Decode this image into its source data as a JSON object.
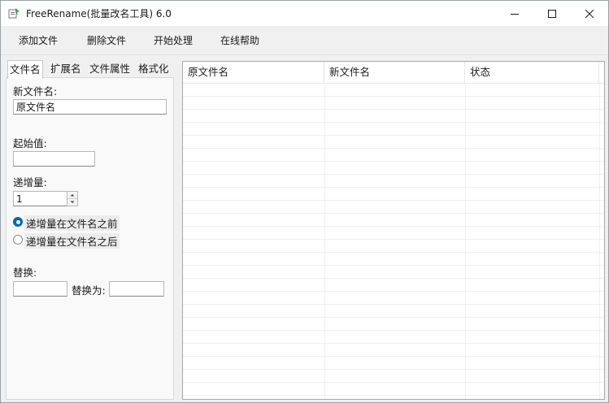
{
  "window": {
    "title": "FreeRename(批量改名工具) 6.0",
    "icons": {
      "app": "app-icon",
      "minimize": "minimize-icon",
      "maximize": "maximize-icon",
      "close": "close-icon"
    }
  },
  "toolbar": {
    "add_files": "添加文件",
    "delete_files": "删除文件",
    "start": "开始处理",
    "help": "在线帮助"
  },
  "tabs": [
    {
      "label": "文件名"
    },
    {
      "label": "扩展名"
    },
    {
      "label": "文件属性"
    },
    {
      "label": "格式化"
    }
  ],
  "filename_tab": {
    "new_name_label": "新文件名:",
    "new_name_value": "原文件名",
    "start_label": "起始值:",
    "start_value": "",
    "increment_label": "递增量:",
    "increment_value": "1",
    "radio_before": "递增量在文件名之前",
    "radio_after": "递增量在文件名之后",
    "radio_selected": "before",
    "replace_label": "替换:",
    "replace_value": "",
    "replace_with_label": "替换为:",
    "replace_with_value": ""
  },
  "table": {
    "columns": [
      "原文件名",
      "新文件名",
      "状态"
    ],
    "rows": []
  }
}
